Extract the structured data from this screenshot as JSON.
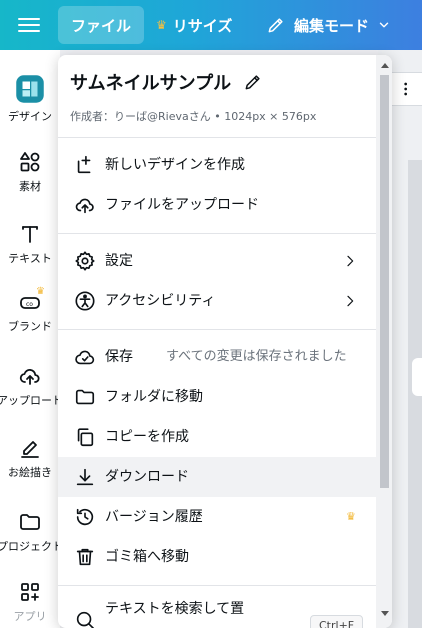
{
  "topbar": {
    "file_label": "ファイル",
    "resize_label": "リサイズ",
    "edit_mode_label": "編集モード"
  },
  "rail": {
    "items": [
      {
        "label": "デザイン"
      },
      {
        "label": "素材"
      },
      {
        "label": "テキスト"
      },
      {
        "label": "ブランド"
      },
      {
        "label": "アップロード"
      },
      {
        "label": "お絵描き"
      },
      {
        "label": "プロジェクト"
      },
      {
        "label": "アプリ"
      }
    ]
  },
  "menu": {
    "title": "サムネイルサンプル",
    "meta": "作成者：りーば@Rievaさん • 1024px × 576px",
    "items": [
      {
        "label": "新しいデザインを作成"
      },
      {
        "label": "ファイルをアップロード"
      },
      {
        "label": "設定"
      },
      {
        "label": "アクセシビリティ"
      },
      {
        "label": "保存",
        "aux": "すべての変更は保存されました"
      },
      {
        "label": "フォルダに移動"
      },
      {
        "label": "コピーを作成"
      },
      {
        "label": "ダウンロード"
      },
      {
        "label": "バージョン履歴"
      },
      {
        "label": "ゴミ箱へ移動"
      },
      {
        "label": "テキストを検索して置",
        "shortcut": "Ctrl+F"
      }
    ]
  },
  "colors": {
    "topbar_start": "#16b7c9",
    "topbar_end": "#3d7fe0",
    "crown": "#f2b630",
    "highlight": "#f1f2f4"
  }
}
